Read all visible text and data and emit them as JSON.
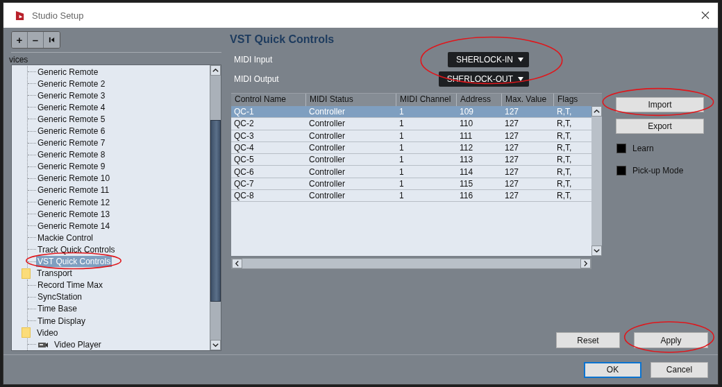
{
  "window": {
    "title": "Studio Setup"
  },
  "toolbar": [
    {
      "kind": "text",
      "label": "+"
    },
    {
      "kind": "text",
      "label": "–"
    },
    {
      "kind": "icon"
    }
  ],
  "tree_header": "vices",
  "tree": [
    {
      "kind": "folder",
      "children": [
        {
          "kind": "item",
          "label": "Generic Remote",
          "selected": false,
          "circled": false
        },
        {
          "kind": "item",
          "label": "Generic Remote 2",
          "selected": false,
          "circled": false
        },
        {
          "kind": "item",
          "label": "Generic Remote 3",
          "selected": false,
          "circled": false
        },
        {
          "kind": "item",
          "label": "Generic Remote 4",
          "selected": false,
          "circled": false
        },
        {
          "kind": "item",
          "label": "Generic Remote 5",
          "selected": false,
          "circled": false
        },
        {
          "kind": "item",
          "label": "Generic Remote 6",
          "selected": false,
          "circled": false
        },
        {
          "kind": "item",
          "label": "Generic Remote 7",
          "selected": false,
          "circled": false
        },
        {
          "kind": "item",
          "label": "Generic Remote 8",
          "selected": false,
          "circled": false
        },
        {
          "kind": "item",
          "label": "Generic Remote 9",
          "selected": false,
          "circled": false
        },
        {
          "kind": "item",
          "label": "Generic Remote 10",
          "selected": false,
          "circled": false
        },
        {
          "kind": "item",
          "label": "Generic Remote 11",
          "selected": false,
          "circled": false
        },
        {
          "kind": "item",
          "label": "Generic Remote 12",
          "selected": false,
          "circled": false
        },
        {
          "kind": "item",
          "label": "Generic Remote 13",
          "selected": false,
          "circled": false
        },
        {
          "kind": "item",
          "label": "Generic Remote 14",
          "selected": false,
          "circled": false
        },
        {
          "kind": "item",
          "label": "Mackie Control",
          "selected": false,
          "circled": false
        },
        {
          "kind": "item",
          "label": "Track Quick Controls",
          "selected": false,
          "circled": false
        },
        {
          "kind": "item",
          "label": "VST Quick Controls",
          "selected": true,
          "circled": true
        }
      ]
    },
    {
      "kind": "folder",
      "label": "Transport",
      "children": [
        {
          "kind": "item",
          "label": "Record Time Max",
          "selected": false,
          "circled": false
        },
        {
          "kind": "item",
          "label": "SyncStation",
          "selected": false,
          "circled": false
        },
        {
          "kind": "item",
          "label": "Time Base",
          "selected": false,
          "circled": false
        },
        {
          "kind": "item",
          "label": "Time Display",
          "selected": false,
          "circled": false
        }
      ]
    },
    {
      "kind": "folder",
      "label": "Video",
      "children": [
        {
          "kind": "media",
          "label": "Video Player",
          "selected": false,
          "circled": false
        }
      ]
    }
  ],
  "panel_title": "VST Quick Controls",
  "midi": {
    "circled": true,
    "rows": [
      {
        "label": "MIDI Input",
        "value": "SHERLOCK-IN"
      },
      {
        "label": "MIDI Output",
        "value": "SHERLOCK-OUT"
      }
    ]
  },
  "table": {
    "columns": [
      "Control Name",
      "MIDI Status",
      "MIDI Channel",
      "Address",
      "Max. Value",
      "Flags"
    ],
    "rows": [
      {
        "cells": [
          "QC-1",
          "Controller",
          "1",
          "109",
          "127",
          "R,T,"
        ],
        "selected": true
      },
      {
        "cells": [
          "QC-2",
          "Controller",
          "1",
          "110",
          "127",
          "R,T,"
        ],
        "selected": false
      },
      {
        "cells": [
          "QC-3",
          "Controller",
          "1",
          "111",
          "127",
          "R,T,"
        ],
        "selected": false
      },
      {
        "cells": [
          "QC-4",
          "Controller",
          "1",
          "112",
          "127",
          "R,T,"
        ],
        "selected": false
      },
      {
        "cells": [
          "QC-5",
          "Controller",
          "1",
          "113",
          "127",
          "R,T,"
        ],
        "selected": false
      },
      {
        "cells": [
          "QC-6",
          "Controller",
          "1",
          "114",
          "127",
          "R,T,"
        ],
        "selected": false
      },
      {
        "cells": [
          "QC-7",
          "Controller",
          "1",
          "115",
          "127",
          "R,T,"
        ],
        "selected": false
      },
      {
        "cells": [
          "QC-8",
          "Controller",
          "1",
          "116",
          "127",
          "R,T,"
        ],
        "selected": false
      }
    ]
  },
  "side_buttons": [
    {
      "label": "Import",
      "circled": true
    },
    {
      "label": "Export",
      "circled": false
    }
  ],
  "options": [
    {
      "label": "Learn",
      "checked": false
    },
    {
      "label": "Pick-up Mode",
      "checked": false
    }
  ],
  "panel_buttons": [
    {
      "label": "Reset",
      "circled": false
    },
    {
      "label": "Apply",
      "circled": true
    }
  ],
  "dialog_buttons": [
    {
      "label": "OK",
      "default": true
    },
    {
      "label": "Cancel",
      "default": false
    }
  ]
}
